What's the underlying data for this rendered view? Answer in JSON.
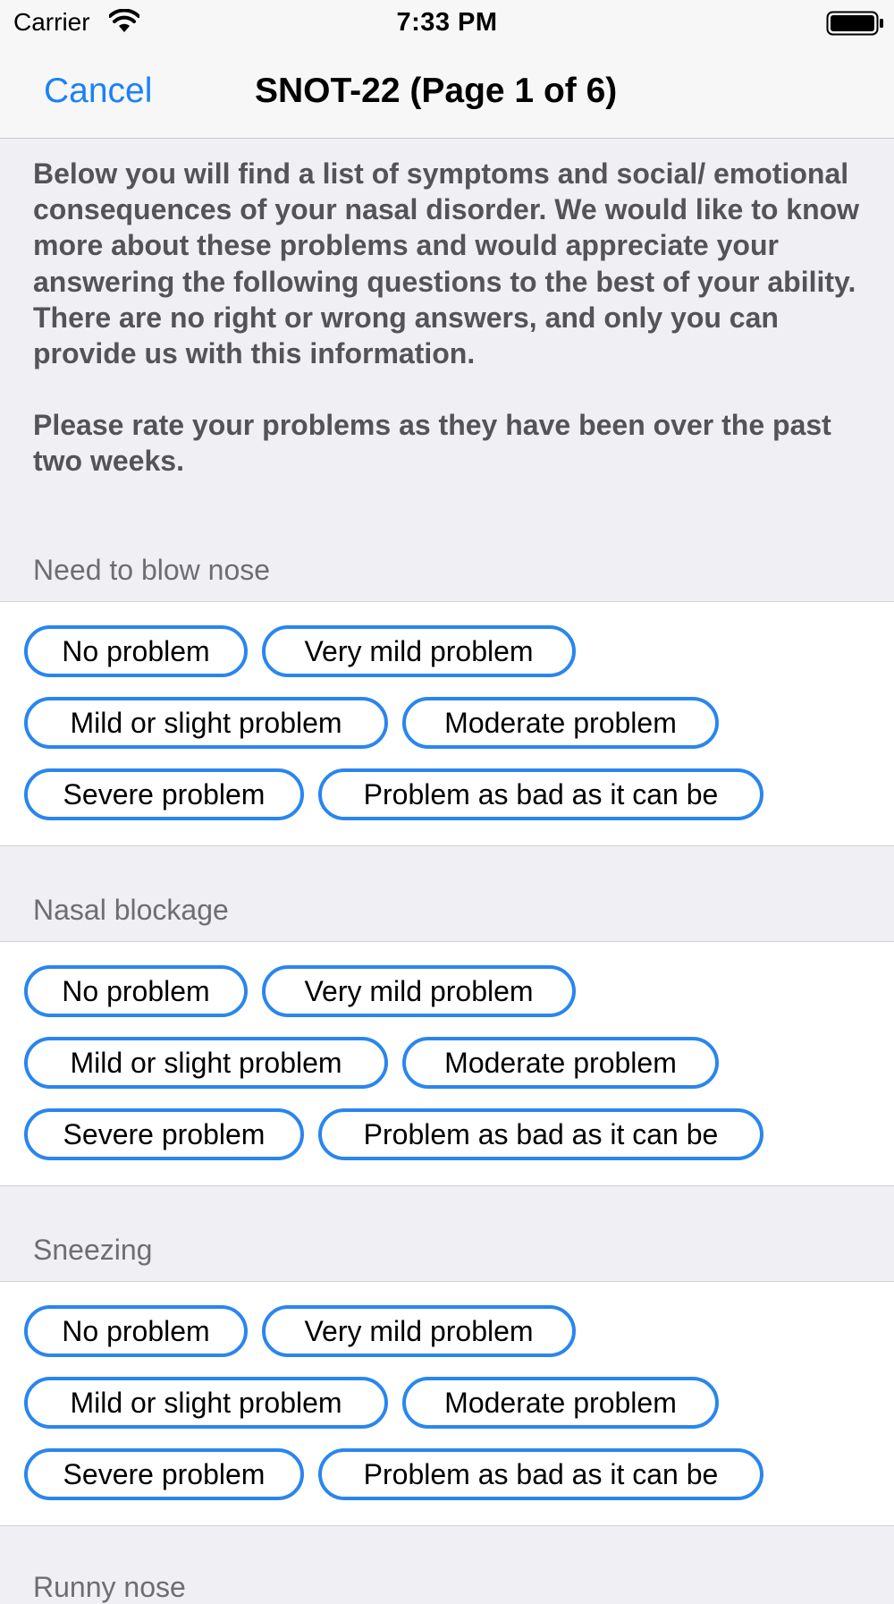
{
  "status_bar": {
    "carrier": "Carrier",
    "time": "7:33 PM",
    "icons": [
      "wifi-icon",
      "battery-icon"
    ]
  },
  "nav": {
    "cancel_label": "Cancel",
    "title": "SNOT-22 (Page 1 of 6)"
  },
  "colors": {
    "accent": "#1a82f6",
    "chip_border": "#2a86ee",
    "background": "#efeff4",
    "header_text": "#6d6d72",
    "intro_text": "#545458"
  },
  "intro": {
    "paragraph1": "Below you will find a list of symptoms and social/ emotional consequences of your nasal disorder. We would like to know more about these problems and would appreciate your answering the following questions to the best of your ability. There are no right or wrong answers, and only you can provide us with this information.",
    "paragraph2": "Please rate your problems as they have been over the past two weeks."
  },
  "questions": [
    {
      "label": "Need to blow nose",
      "options": [
        "No problem",
        "Very mild problem",
        "Mild or slight problem",
        "Moderate problem",
        "Severe problem",
        "Problem as bad as it can be"
      ]
    },
    {
      "label": "Nasal blockage",
      "options": [
        "No problem",
        "Very mild problem",
        "Mild or slight problem",
        "Moderate problem",
        "Severe problem",
        "Problem as bad as it can be"
      ]
    },
    {
      "label": "Sneezing",
      "options": [
        "No problem",
        "Very mild problem",
        "Mild or slight problem",
        "Moderate problem",
        "Severe problem",
        "Problem as bad as it can be"
      ]
    },
    {
      "label": "Runny nose",
      "options": []
    }
  ]
}
